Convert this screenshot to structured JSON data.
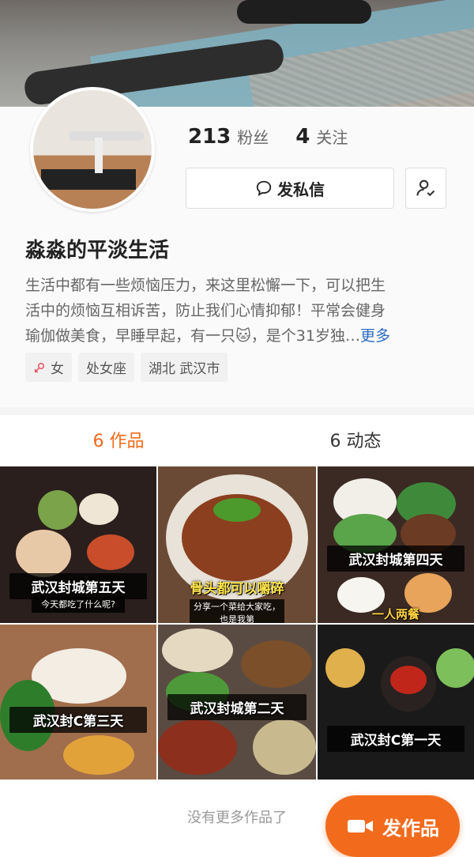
{
  "profile": {
    "followers_count": "213",
    "followers_label": "粉丝",
    "following_count": "4",
    "following_label": "关注",
    "message_button_label": "发私信",
    "name": "淼淼的平淡生活",
    "bio_line1": "生活中都有一些烦恼压力，来这里松懈一下，可以把生",
    "bio_line2": "活中的烦恼互相诉苦，防止我们心情抑郁！平常会健身",
    "bio_line3": "瑜伽做美食，早睡早起，有一只🐱，是个31岁独…",
    "bio_more": "更多",
    "tags": [
      "女",
      "处女座",
      "湖北 武汉市"
    ]
  },
  "tabs": {
    "works": "6 作品",
    "moments": "6 动态"
  },
  "works": [
    {
      "caption": "武汉封城第五天",
      "subcaption": "今天都吃了什么呢?"
    },
    {
      "caption": "骨头都可以嚼碎",
      "subcaption": "分享一个菜给大家吃，也是我第"
    },
    {
      "caption": "武汉封城第四天",
      "subcaption": "一人两餐"
    },
    {
      "caption": "武汉封C第三天",
      "subcaption": ""
    },
    {
      "caption": "武汉封城第二天",
      "subcaption": ""
    },
    {
      "caption": "武汉封C第一天",
      "subcaption": ""
    }
  ],
  "footer": {
    "no_more": "没有更多作品了",
    "post_button": "发作品"
  },
  "colors": {
    "accent": "#f26b1d",
    "link": "#2b6cc4"
  }
}
